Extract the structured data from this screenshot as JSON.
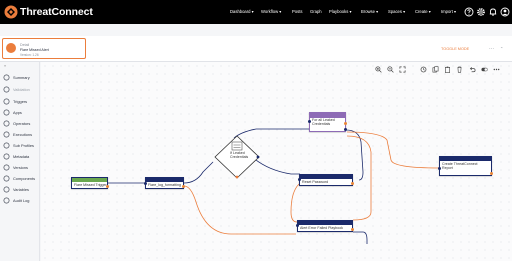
{
  "brand": {
    "name": "ThreatConnect",
    "accent": "#eb7d3c"
  },
  "nav": {
    "items": [
      "Dashboard ▾",
      "Workflow ▾",
      "Posts",
      "Graph",
      "Playbooks ▾",
      "Browse ▾",
      "Spaces ▾",
      "Create ▾",
      "Import ▾"
    ],
    "icons": [
      "help-icon",
      "settings-icon",
      "notifications-icon",
      "user-icon"
    ]
  },
  "playbook": {
    "kind": "Detail",
    "title": "Flare Missed Alert",
    "version": "Version: 1.26",
    "status": "TOGGLE MODE",
    "more": "···"
  },
  "sidebar": {
    "collapse_icon": "chevrons-left-icon",
    "items": [
      {
        "label": "Summary",
        "icon": "info-icon"
      },
      {
        "label": "Validation",
        "icon": "check-icon"
      },
      {
        "label": "Triggers",
        "icon": "bolt-icon"
      },
      {
        "label": "Apps",
        "icon": "app-icon"
      },
      {
        "label": "Operators",
        "icon": "diamond-icon"
      },
      {
        "label": "Executions",
        "icon": "clock-icon"
      },
      {
        "label": "Sub Profiles",
        "icon": "link-icon"
      },
      {
        "label": "Metadata",
        "icon": "tag-icon"
      },
      {
        "label": "Versions",
        "icon": "history-icon"
      },
      {
        "label": "Components",
        "icon": "component-icon"
      },
      {
        "label": "Variables",
        "icon": "variable-icon"
      },
      {
        "label": "Audit Log",
        "icon": "list-icon"
      }
    ]
  },
  "toolbar": {
    "icons": [
      "zoom-in-icon",
      "zoom-out-icon",
      "fit-icon",
      "history-icon",
      "copy-icon",
      "paste-icon",
      "delete-icon",
      "undo-icon",
      "toggle-icon",
      "more-icon"
    ]
  },
  "nodes": {
    "trigger": {
      "label": "Flare Missed Trigger",
      "color": "#6aa84f"
    },
    "log": {
      "label": "Flare_log_formatting",
      "color": "#1b2a6b"
    },
    "operator": {
      "label": "If Leaked\nCredentials",
      "color": "#8a8f98"
    },
    "foreach": {
      "label": "For all Leaked\nCredentials",
      "color": "#8e6bb6"
    },
    "reset": {
      "label": "Reset Password",
      "color": "#1b2a6b"
    },
    "alert": {
      "label": "Alert Error Failed Playbook",
      "color": "#1b2a6b"
    },
    "report": {
      "label": "Create ThreatConnect\nReport",
      "color": "#1b2a6b"
    }
  }
}
